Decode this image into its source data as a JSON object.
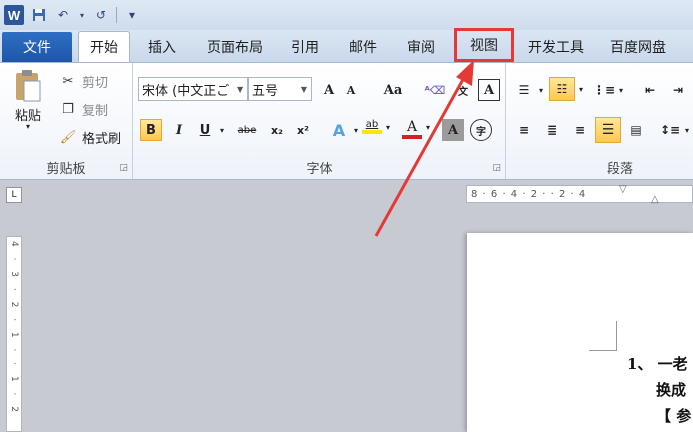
{
  "app": {
    "logo_letter": "W"
  },
  "quick_access": {
    "undo_glyph": "↶",
    "redo_glyph": "↺",
    "customize_glyph": "▾"
  },
  "tabs": {
    "file": "文件",
    "home": "开始",
    "insert": "插入",
    "page_layout": "页面布局",
    "references": "引用",
    "mailings": "邮件",
    "review": "审阅",
    "view": "视图",
    "developer": "开发工具",
    "baidu_disk": "百度网盘"
  },
  "clipboard": {
    "paste": "粘贴",
    "cut": "剪切",
    "copy": "复制",
    "format_painter": "格式刷",
    "group_label": "剪贴板"
  },
  "font": {
    "font_name": "宋体 (中文正ご",
    "font_size": "五号",
    "grow": "A",
    "shrink": "A",
    "change_case": "Aa",
    "bold": "B",
    "italic": "I",
    "underline": "U",
    "strike": "abe",
    "subscript": "x₂",
    "superscript": "x²",
    "text_effect": "A",
    "highlight": "ab",
    "font_color": "A",
    "char_shading": "A",
    "enclose": "字",
    "group_label": "字体"
  },
  "paragraph": {
    "group_label": "段落"
  },
  "document": {
    "line1": "1、 一老",
    "line2": "换成",
    "line3": "【 参"
  },
  "ruler": {
    "h_ticks": "8 · 6 · 4 · 2 ·   · 2 · 4",
    "v_ticks": "4 · 3 · 2 · 1 ·   · 1 · 2"
  },
  "colors": {
    "accent_red": "#e53935",
    "highlight_yellow": "#ffe600",
    "font_red": "#d81e1e",
    "word_blue": "#2b579a"
  },
  "annotation": {
    "arrow_target": "view-tab"
  }
}
